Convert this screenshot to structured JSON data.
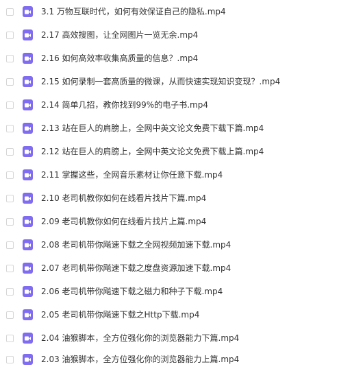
{
  "files": [
    {
      "name": "3.1 万物互联时代，如何有效保证自己的隐私.mp4",
      "icon": "video-file-icon"
    },
    {
      "name": "2.17 高效搜图，让全网图片一览无余.mp4",
      "icon": "video-file-icon"
    },
    {
      "name": "2.16 如何高效率收集高质量的信息？.mp4",
      "icon": "video-file-icon"
    },
    {
      "name": "2.15 如何录制一套高质量的微课，从而快速实现知识变现？.mp4",
      "icon": "video-file-icon"
    },
    {
      "name": "2.14 简单几招，教你找到99%的电子书.mp4",
      "icon": "video-file-icon"
    },
    {
      "name": "2.13 站在巨人的肩膀上，全网中英文论文免费下载下篇.mp4",
      "icon": "video-file-icon"
    },
    {
      "name": "2.12 站在巨人的肩膀上，全网中英文论文免费下载上篇.mp4",
      "icon": "video-file-icon"
    },
    {
      "name": "2.11 掌握这些，全网音乐素材让你任意下载.mp4",
      "icon": "video-file-icon"
    },
    {
      "name": "2.10 老司机教你如何在线看片找片下篇.mp4",
      "icon": "video-file-icon"
    },
    {
      "name": "2.09 老司机教你如何在线看片找片上篇.mp4",
      "icon": "video-file-icon"
    },
    {
      "name": "2.08 老司机带你飚速下载之全网视频加速下载.mp4",
      "icon": "video-file-icon"
    },
    {
      "name": "2.07 老司机带你飚速下载之度盘资源加速下载.mp4",
      "icon": "video-file-icon"
    },
    {
      "name": "2.06 老司机带你飚速下载之磁力和种子下载.mp4",
      "icon": "video-file-icon"
    },
    {
      "name": "2.05 老司机带你飚速下载之Http下载.mp4",
      "icon": "video-file-icon"
    },
    {
      "name": "2.04 油猴脚本，全方位强化你的浏览器能力下篇.mp4",
      "icon": "video-file-icon"
    },
    {
      "name": "2.03 油猴脚本，全方位强化你的浏览器能力上篇.mp4",
      "icon": "video-file-icon"
    }
  ],
  "colors": {
    "icon_background": "#7f6cf0",
    "text": "#333333",
    "checkbox_border": "#d6d6d6"
  }
}
